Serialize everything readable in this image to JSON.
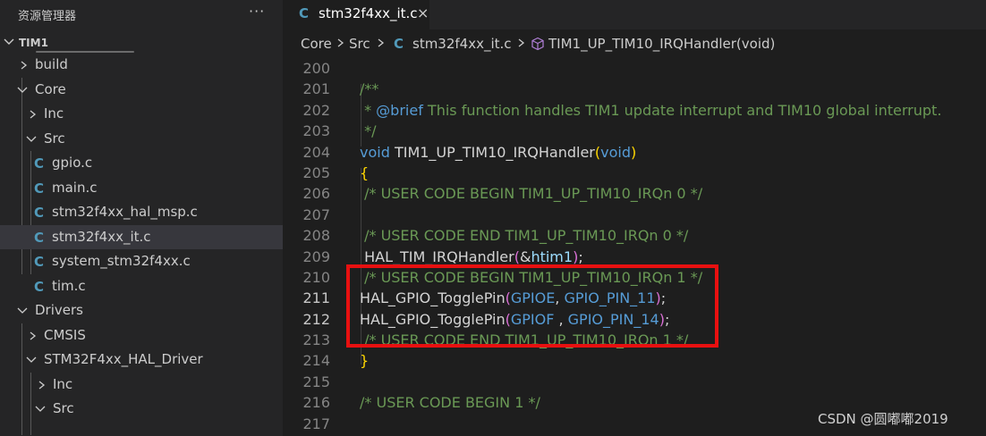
{
  "explorer": {
    "title": "资源管理器",
    "more": "···",
    "root": "TIM1",
    "items": [
      {
        "label": "build",
        "depth": 1,
        "kind": "folder",
        "expanded": false
      },
      {
        "label": "Core",
        "depth": 1,
        "kind": "folder",
        "expanded": true
      },
      {
        "label": "Inc",
        "depth": 2,
        "kind": "folder",
        "expanded": false
      },
      {
        "label": "Src",
        "depth": 2,
        "kind": "folder",
        "expanded": true
      },
      {
        "label": "gpio.c",
        "depth": 3,
        "kind": "c-file"
      },
      {
        "label": "main.c",
        "depth": 3,
        "kind": "c-file"
      },
      {
        "label": "stm32f4xx_hal_msp.c",
        "depth": 3,
        "kind": "c-file"
      },
      {
        "label": "stm32f4xx_it.c",
        "depth": 3,
        "kind": "c-file",
        "selected": true
      },
      {
        "label": "system_stm32f4xx.c",
        "depth": 3,
        "kind": "c-file"
      },
      {
        "label": "tim.c",
        "depth": 3,
        "kind": "c-file"
      },
      {
        "label": "Drivers",
        "depth": 1,
        "kind": "folder",
        "expanded": true
      },
      {
        "label": "CMSIS",
        "depth": 2,
        "kind": "folder",
        "expanded": false
      },
      {
        "label": "STM32F4xx_HAL_Driver",
        "depth": 2,
        "kind": "folder",
        "expanded": true
      },
      {
        "label": "Inc",
        "depth": 3,
        "kind": "folder",
        "expanded": false
      },
      {
        "label": "Src",
        "depth": 3,
        "kind": "folder",
        "expanded": true
      }
    ]
  },
  "tab": {
    "icon": "C",
    "label": "stm32f4xx_it.c",
    "close": "×"
  },
  "breadcrumb": {
    "parts": [
      "Core",
      "Src",
      "stm32f4xx_it.c",
      "TIM1_UP_TIM10_IRQHandler(void)"
    ],
    "file_icon": "C"
  },
  "code": {
    "lines": [
      {
        "n": "200",
        "text": ""
      },
      {
        "n": "201",
        "text": "/**"
      },
      {
        "n": "202",
        "text": " * @brief This function handles TIM1 update interrupt and TIM10 global interrupt."
      },
      {
        "n": "203",
        "text": " */"
      },
      {
        "n": "204",
        "text": "void TIM1_UP_TIM10_IRQHandler(void)"
      },
      {
        "n": "205",
        "text": "{"
      },
      {
        "n": "206",
        "text": " /* USER CODE BEGIN TIM1_UP_TIM10_IRQn 0 */"
      },
      {
        "n": "207",
        "text": ""
      },
      {
        "n": "208",
        "text": " /* USER CODE END TIM1_UP_TIM10_IRQn 0 */"
      },
      {
        "n": "209",
        "text": " HAL_TIM_IRQHandler(&htim1);"
      },
      {
        "n": "210",
        "text": " /* USER CODE BEGIN TIM1_UP_TIM10_IRQn 1 */"
      },
      {
        "n": "211",
        "text": "HAL_GPIO_TogglePin(GPIOE, GPIO_PIN_11);"
      },
      {
        "n": "212",
        "text": "HAL_GPIO_TogglePin(GPIOF , GPIO_PIN_14);"
      },
      {
        "n": "213",
        "text": " /* USER CODE END TIM1_UP_TIM10_IRQn 1 */"
      },
      {
        "n": "214",
        "text": "}"
      },
      {
        "n": "215",
        "text": ""
      },
      {
        "n": "216",
        "text": "/* USER CODE BEGIN 1 */"
      },
      {
        "n": "217",
        "text": ""
      }
    ],
    "active_lines": [
      "211",
      "212"
    ]
  },
  "colors": {
    "comment": "#6a9955",
    "keyword": "#569cd6",
    "function": "#dcdcaa",
    "highlight_box": "#e81010",
    "c_icon": "#519aba"
  },
  "watermark": "CSDN @圆嘟嘟2019"
}
